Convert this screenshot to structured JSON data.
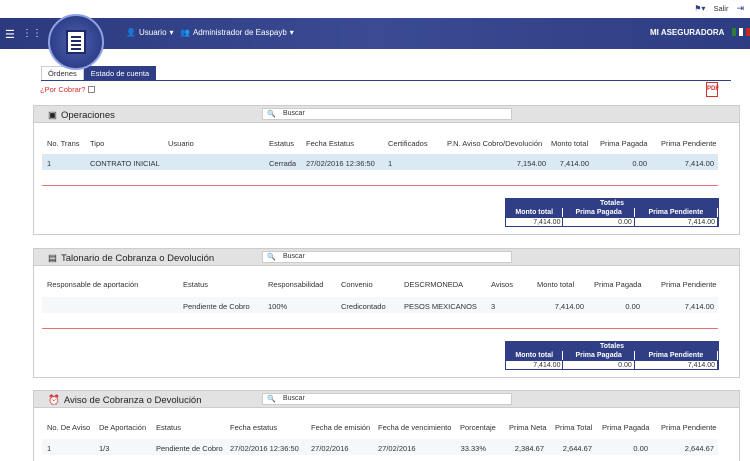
{
  "topbar": {
    "salir": "Salir"
  },
  "nav": {
    "usuario": "Usuario",
    "admin": "Administrador de Easpayb",
    "brand": "MI ASEGURADORA"
  },
  "tabs": [
    "Órdenes",
    "Estado de cuenta"
  ],
  "porcobrar": "¿Por Cobrar?",
  "search_placeholder": "Buscar",
  "operaciones": {
    "title": "Operaciones",
    "headers": [
      "No. Trans",
      "Tipo",
      "Usuario",
      "Estatus",
      "Fecha Estatus",
      "Certificados",
      "P.N. Aviso Cobro/Devolución",
      "Monto total",
      "Prima Pagada",
      "Prima Pendiente"
    ],
    "row": [
      "1",
      "CONTRATO INICIAL",
      "",
      "Cerrada",
      "27/02/2016 12:36:50",
      "1",
      "7,154.00",
      "7,414.00",
      "0.00",
      "7,414.00"
    ],
    "totals": {
      "title": "Totales",
      "headers": [
        "Monto total",
        "Prima Pagada",
        "Prima Pendiente"
      ],
      "values": [
        "7,414.00",
        "0.00",
        "7,414.00"
      ]
    }
  },
  "talonario": {
    "title": "Talonario de Cobranza o Devolución",
    "headers": [
      "Responsable de aportación",
      "Estatus",
      "Responsabilidad",
      "Convenio",
      "DESCRMONEDA",
      "Avisos",
      "Monto total",
      "Prima Pagada",
      "Prima Pendiente"
    ],
    "row": [
      "",
      "Pendiente de Cobro",
      "100%",
      "Credicontado",
      "PESOS MEXICANOS",
      "3",
      "7,414.00",
      "0.00",
      "7,414.00"
    ],
    "totals": {
      "title": "Totales",
      "headers": [
        "Monto total",
        "Prima Pagada",
        "Prima Pendiente"
      ],
      "values": [
        "7,414.00",
        "0.00",
        "7,414.00"
      ]
    }
  },
  "aviso": {
    "title": "Aviso de Cobranza o Devolución",
    "headers": [
      "No. De Aviso",
      "De Aportación",
      "Estatus",
      "Fecha estatus",
      "Fecha de emisión",
      "Fecha de vencimiento",
      "Porcentaje",
      "Prima Neta",
      "Prima Total",
      "Prima Pagada",
      "Prima Pendiente"
    ],
    "row": [
      "1",
      "1/3",
      "Pendiente de Cobro",
      "27/02/2016 12:36:50",
      "27/02/2016",
      "27/02/2016",
      "33.33%",
      "2,384.67",
      "2,644.67",
      "0.00",
      "2,644.67"
    ]
  }
}
